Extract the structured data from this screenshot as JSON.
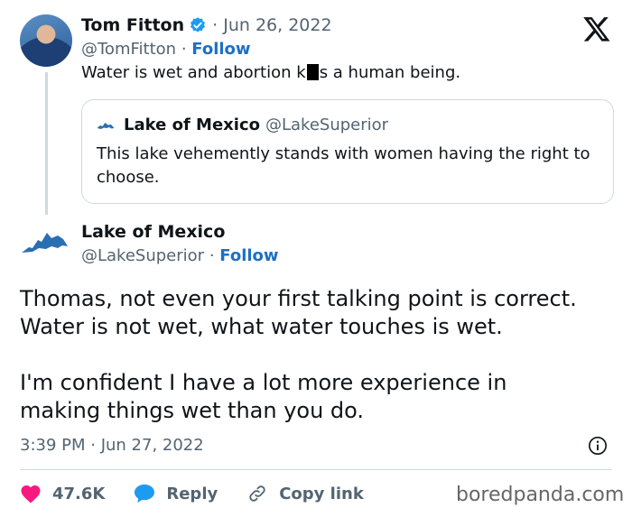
{
  "colors": {
    "link": "#1d70c4",
    "like": "#f91880",
    "reply": "#1d9bf0",
    "muted": "#536471",
    "border": "#cfd9de"
  },
  "original_tweet": {
    "author_name": "Tom Fitton",
    "verified_icon": "verified-badge-icon",
    "date": "· Jun 26, 2022",
    "handle": "@TomFitton",
    "separator": "·",
    "follow_label": "Follow",
    "text_before": "Water is wet and abortion k",
    "text_after": "s a human being."
  },
  "quoted_tweet": {
    "author_name": "Lake of Mexico",
    "handle": "@LakeSuperior",
    "text": "This lake vehemently stands with women having the right to choose."
  },
  "reply_tweet": {
    "author_name": "Lake of Mexico",
    "handle": "@LakeSuperior",
    "separator": "·",
    "follow_label": "Follow",
    "body_line1": "Thomas, not even your first talking point is correct.",
    "body_line2": "Water is not wet, what water touches is wet.",
    "body_line3": "I'm confident I have a lot more experience in",
    "body_line4": "making things wet than you do.",
    "timestamp": "3:39 PM · Jun 27, 2022"
  },
  "actions": {
    "like_count": "47.6K",
    "reply_label": "Reply",
    "copy_link_label": "Copy link"
  },
  "watermark": "boredpanda.com"
}
